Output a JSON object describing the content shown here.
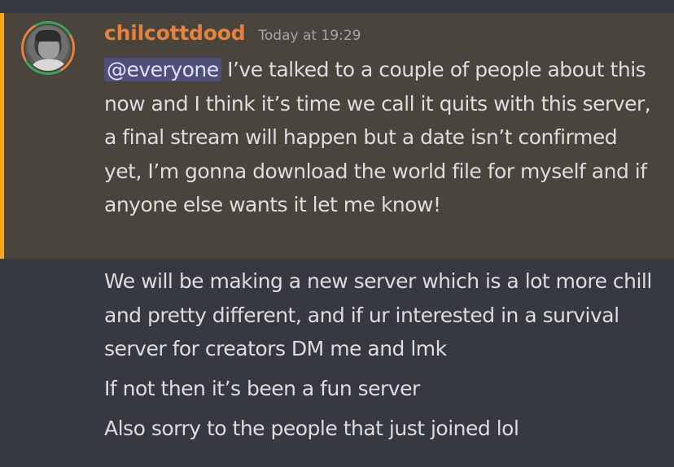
{
  "message_group": {
    "author": "chilcottdood",
    "timestamp": "Today at 19:29",
    "colors": {
      "username": "#e8823a",
      "mention_highlight": "#faa61a",
      "background": "#36393f"
    },
    "messages": [
      {
        "mention": "@everyone",
        "text": " I’ve talked to a couple of people about this now and I think it’s time we call it quits with this server, a final stream will happen but a date isn’t confirmed yet, I’m gonna download the world file for myself and if anyone else wants it let me know!"
      },
      {
        "text": "We will be making a new server which is a lot more chill and pretty different, and if ur interested in a survival server for creators DM me and lmk"
      },
      {
        "text": "If not then it’s been a fun server"
      },
      {
        "text": "Also sorry to the people that just joined lol"
      }
    ]
  }
}
